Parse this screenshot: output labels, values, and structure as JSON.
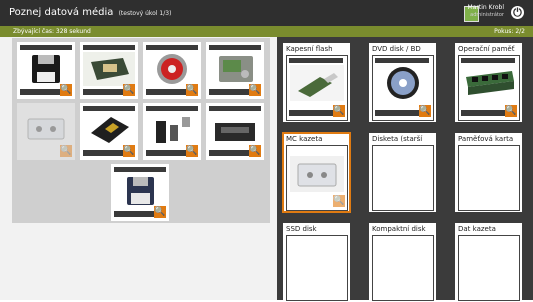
{
  "header": {
    "title": "Poznej datová média",
    "subtitle": "(testový úkol 1/3)",
    "user_name": "Martin Krobl",
    "user_role": "administrátor",
    "user_icon": "user-avatar-icon",
    "power_icon": "power-icon",
    "power_glyph": "⏻"
  },
  "status": {
    "time_text": "Zbývající čas: 328 sekund",
    "tries_text": "Pokus: 2/2"
  },
  "colors": {
    "accent": "#e07b12",
    "status_bar": "#7a8c2e",
    "top_bar": "#2f2f2f",
    "drop_area": "#3b3b3b"
  },
  "source_tiles": [
    {
      "icon": "floppy-disk-image",
      "mag": "🔍"
    },
    {
      "icon": "memory-card-image",
      "mag": "🔍"
    },
    {
      "icon": "cd-disc-image",
      "mag": "🔍"
    },
    {
      "icon": "hard-drive-image",
      "mag": "🔍"
    },
    {
      "icon": "cassette-tape-image",
      "mag": "🔍"
    },
    {
      "icon": "ssd-image",
      "mag": "🔍"
    },
    {
      "icon": "usb-drive-image",
      "mag": "🔍"
    },
    {
      "icon": "dat-tape-image",
      "mag": "🔍"
    },
    {
      "icon": "floppy-disk-blue-image",
      "mag": "🔍"
    }
  ],
  "targets": [
    {
      "label": "Kapesní flash",
      "icon": "usb-flash-image",
      "mag": "🔍"
    },
    {
      "label": "DVD disk / BD",
      "icon": "dvd-disc-image",
      "mag": "🔍"
    },
    {
      "label": "Operační paměť",
      "icon": "ram-module-image",
      "mag": "🔍"
    },
    {
      "label": "MC kazeta",
      "icon": "cassette-tape-image",
      "mag": "🔍"
    },
    {
      "label": "Disketa (starší",
      "icon": "",
      "mag": ""
    },
    {
      "label": "Paměťová karta",
      "icon": "",
      "mag": ""
    },
    {
      "label": "SSD disk",
      "icon": "",
      "mag": ""
    },
    {
      "label": "Kompaktní disk",
      "icon": "",
      "mag": ""
    },
    {
      "label": "Dat kazeta",
      "icon": "",
      "mag": ""
    }
  ]
}
